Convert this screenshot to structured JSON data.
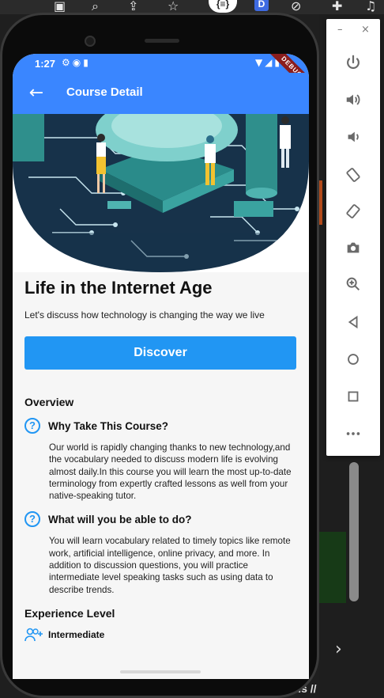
{
  "host": {
    "bottom_text": "nds //"
  },
  "emulator_toolbar": {
    "minimize_label": "–",
    "close_label": "×"
  },
  "status_bar": {
    "time": "1:27",
    "debug_label": "DEBUG"
  },
  "app_bar": {
    "title": "Course Detail"
  },
  "course": {
    "title": "Life in the Internet Age",
    "subtitle": "Let's discuss how technology is changing the way we live",
    "cta_label": "Discover",
    "overview_heading": "Overview",
    "sections": [
      {
        "title": "Why Take This Course?",
        "body": "Our world is rapidly changing thanks to new technology,and the vocabulary needed to discuss modern life is evolving almost daily.In this course you will learn the most up-to-date terminology from expertly crafted lessons as well from your native-speaking tutor."
      },
      {
        "title": "What will you be able to do?",
        "body": "You will learn vocabulary related to timely topics like remote work, artificial intelligence, online privacy, and more. In addition to discussion questions, you will practice intermediate level speaking tasks such as using data to describe trends."
      }
    ],
    "experience_heading": "Experience Level",
    "experience_level": "Intermediate"
  },
  "colors": {
    "primary": "#3a86ff",
    "button": "#2196f3",
    "hero_dark": "#17324a",
    "hero_teal": "#4fb3b0"
  }
}
